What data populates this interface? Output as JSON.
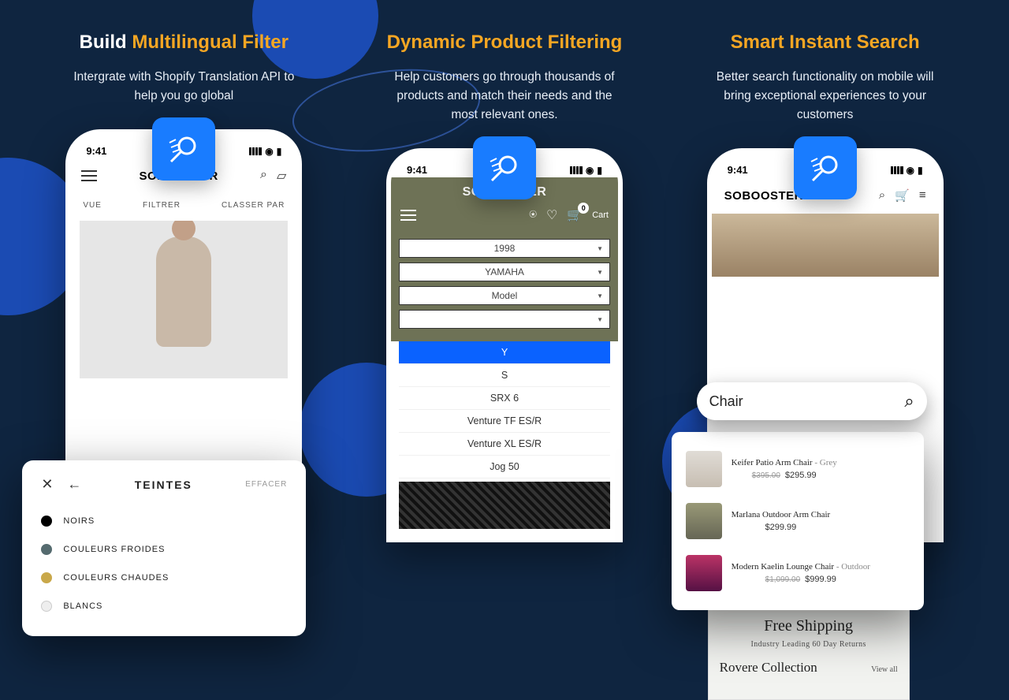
{
  "cols": [
    {
      "title_white": "Build ",
      "title_gold": "Multilingual Filter",
      "desc": "Intergrate with Shopify Translation API to help you go global"
    },
    {
      "title_gold": "Dynamic Product Filtering",
      "desc": "Help customers go through thousands of products and match their needs and the most relevant ones."
    },
    {
      "title_gold": "Smart Instant Search",
      "desc": "Better search functionality on mobile will bring exceptional experiences to your customers"
    }
  ],
  "statusbar": {
    "time": "9:41"
  },
  "phone1": {
    "brand": "SOBOOSTER",
    "tabs": {
      "view": "VUE",
      "filter": "FILTRER",
      "sort": "CLASSER PAR"
    },
    "panel": {
      "title": "TEINTES",
      "clear": "EFFACER",
      "items": [
        "NOIRS",
        "COULEURS FROIDES",
        "COULEURS CHAUDES",
        "BLANCS"
      ]
    }
  },
  "phone2": {
    "brand": "SOBOOSTER",
    "cart_label": "Cart",
    "cart_count": "0",
    "selects": {
      "year": "1998",
      "make": "YAMAHA",
      "model": "Model"
    },
    "dropdown": [
      "Y",
      "S",
      "SRX 6",
      "Venture TF ES/R",
      "Venture XL ES/R",
      "Jog 50"
    ]
  },
  "phone3": {
    "brand": "SOBOOSTER",
    "search_value": "Chair",
    "results": [
      {
        "title": "Keifer Patio Arm Chair",
        "variant": " - Grey",
        "old": "$395.00",
        "price": "$295.99"
      },
      {
        "title": "Marlana Outdoor Arm Chair",
        "variant": "",
        "price": "$299.99"
      },
      {
        "title": "Modern Kaelin Lounge Chair",
        "variant": " - Outdoor",
        "old": "$1,099.00",
        "price": "$999.99"
      }
    ],
    "banner": {
      "big": "Free Shipping",
      "small": "Industry Leading 60 Day Returns"
    },
    "collection": {
      "title": "Rovere Collection",
      "link": "View all"
    }
  }
}
